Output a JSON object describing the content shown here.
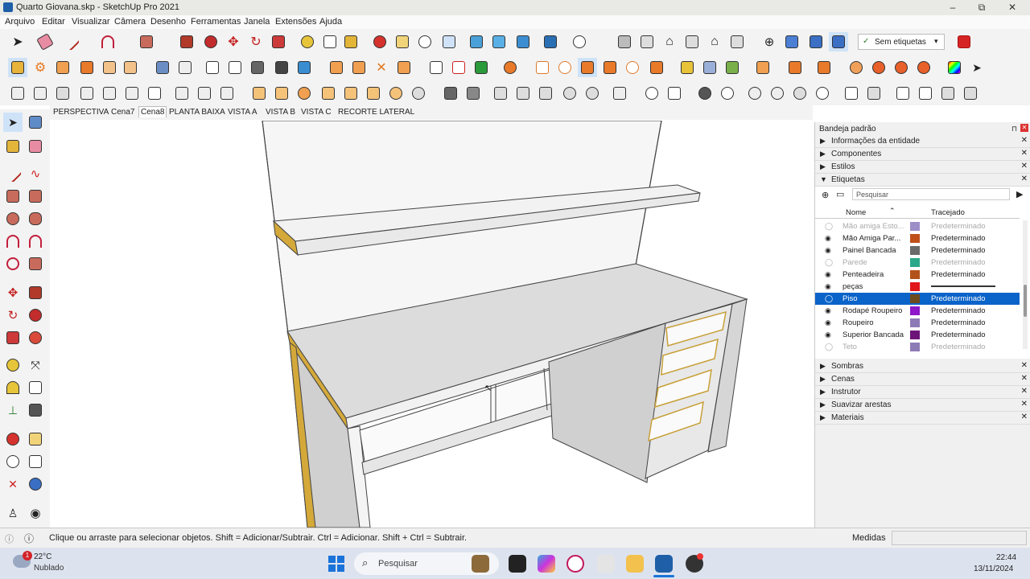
{
  "window": {
    "title": "Quarto Giovana.skp - SketchUp Pro 2021",
    "min": "–",
    "max": "⧉",
    "close": "✕"
  },
  "menu": [
    "Arquivo",
    "Editar",
    "Visualizar",
    "Câmera",
    "Desenho",
    "Ferramentas",
    "Janela",
    "Extensões",
    "Ajuda"
  ],
  "toolbar": {
    "tag_dropdown": "Sem etiquetas",
    "check": "✓"
  },
  "scenes": [
    "PERSPECTIVA",
    "Cena7",
    "Cena8",
    "PLANTA BAIXA",
    "VISTA  A",
    "VISTA B",
    "VISTA  C",
    "RECORTE LATERAL"
  ],
  "tray": {
    "title": "Bandeja padrão",
    "panels_top": [
      {
        "label": "Informações da entidade",
        "arrow": "▶"
      },
      {
        "label": "Componentes",
        "arrow": "▶"
      },
      {
        "label": "Estilos",
        "arrow": "▶"
      },
      {
        "label": "Etiquetas",
        "arrow": "▼"
      }
    ],
    "tags": {
      "search_placeholder": "Pesquisar",
      "col_name": "Nome",
      "col_dash": "Tracejado",
      "rows": [
        {
          "name": "Mão amiga Esto...",
          "color": "#9c8ec7",
          "dash": "Predeterminado",
          "visible": false
        },
        {
          "name": "Mão Amiga Par...",
          "color": "#c0501a",
          "dash": "Predeterminado",
          "visible": true
        },
        {
          "name": "Painel Bancada",
          "color": "#6a6a6a",
          "dash": "Predeterminado",
          "visible": true
        },
        {
          "name": "Parede",
          "color": "#2aa88a",
          "dash": "Predeterminado",
          "visible": false
        },
        {
          "name": "Penteadeira",
          "color": "#b2521a",
          "dash": "Predeterminado",
          "visible": true
        },
        {
          "name": "peças",
          "color": "#e0161b",
          "dash": "",
          "visible": true
        },
        {
          "name": "Piso",
          "color": "#6d4a1f",
          "dash": "Predeterminado",
          "visible": false
        },
        {
          "name": "Rodapé Roupeiro",
          "color": "#8d17c9",
          "dash": "Predeterminado",
          "visible": true
        },
        {
          "name": "Roupeiro",
          "color": "#8d7bb6",
          "dash": "Predeterminado",
          "visible": true
        },
        {
          "name": "Superior Bancada",
          "color": "#6c1478",
          "dash": "Predeterminado",
          "visible": true
        },
        {
          "name": "Teto",
          "color": "#8d7bb6",
          "dash": "Predeterminado",
          "visible": false
        }
      ]
    },
    "panels_bottom": [
      "Sombras",
      "Cenas",
      "Instrutor",
      "Suavizar arestas",
      "Materiais"
    ]
  },
  "status": {
    "message": "Clique ou arraste para selecionar objetos. Shift = Adicionar/Subtrair. Ctrl = Adicionar. Shift + Ctrl = Subtrair.",
    "measures_label": "Medidas"
  },
  "taskbar": {
    "weather_temp": "22°C",
    "weather_desc": "Nublado",
    "weather_badge": "1",
    "search_placeholder": "Pesquisar",
    "time": "22:44",
    "date": "13/11/2024"
  },
  "colors": {
    "selection": "#0a63c9",
    "accent": "#1f5fa8",
    "edge_highlight": "#d4a93a"
  }
}
